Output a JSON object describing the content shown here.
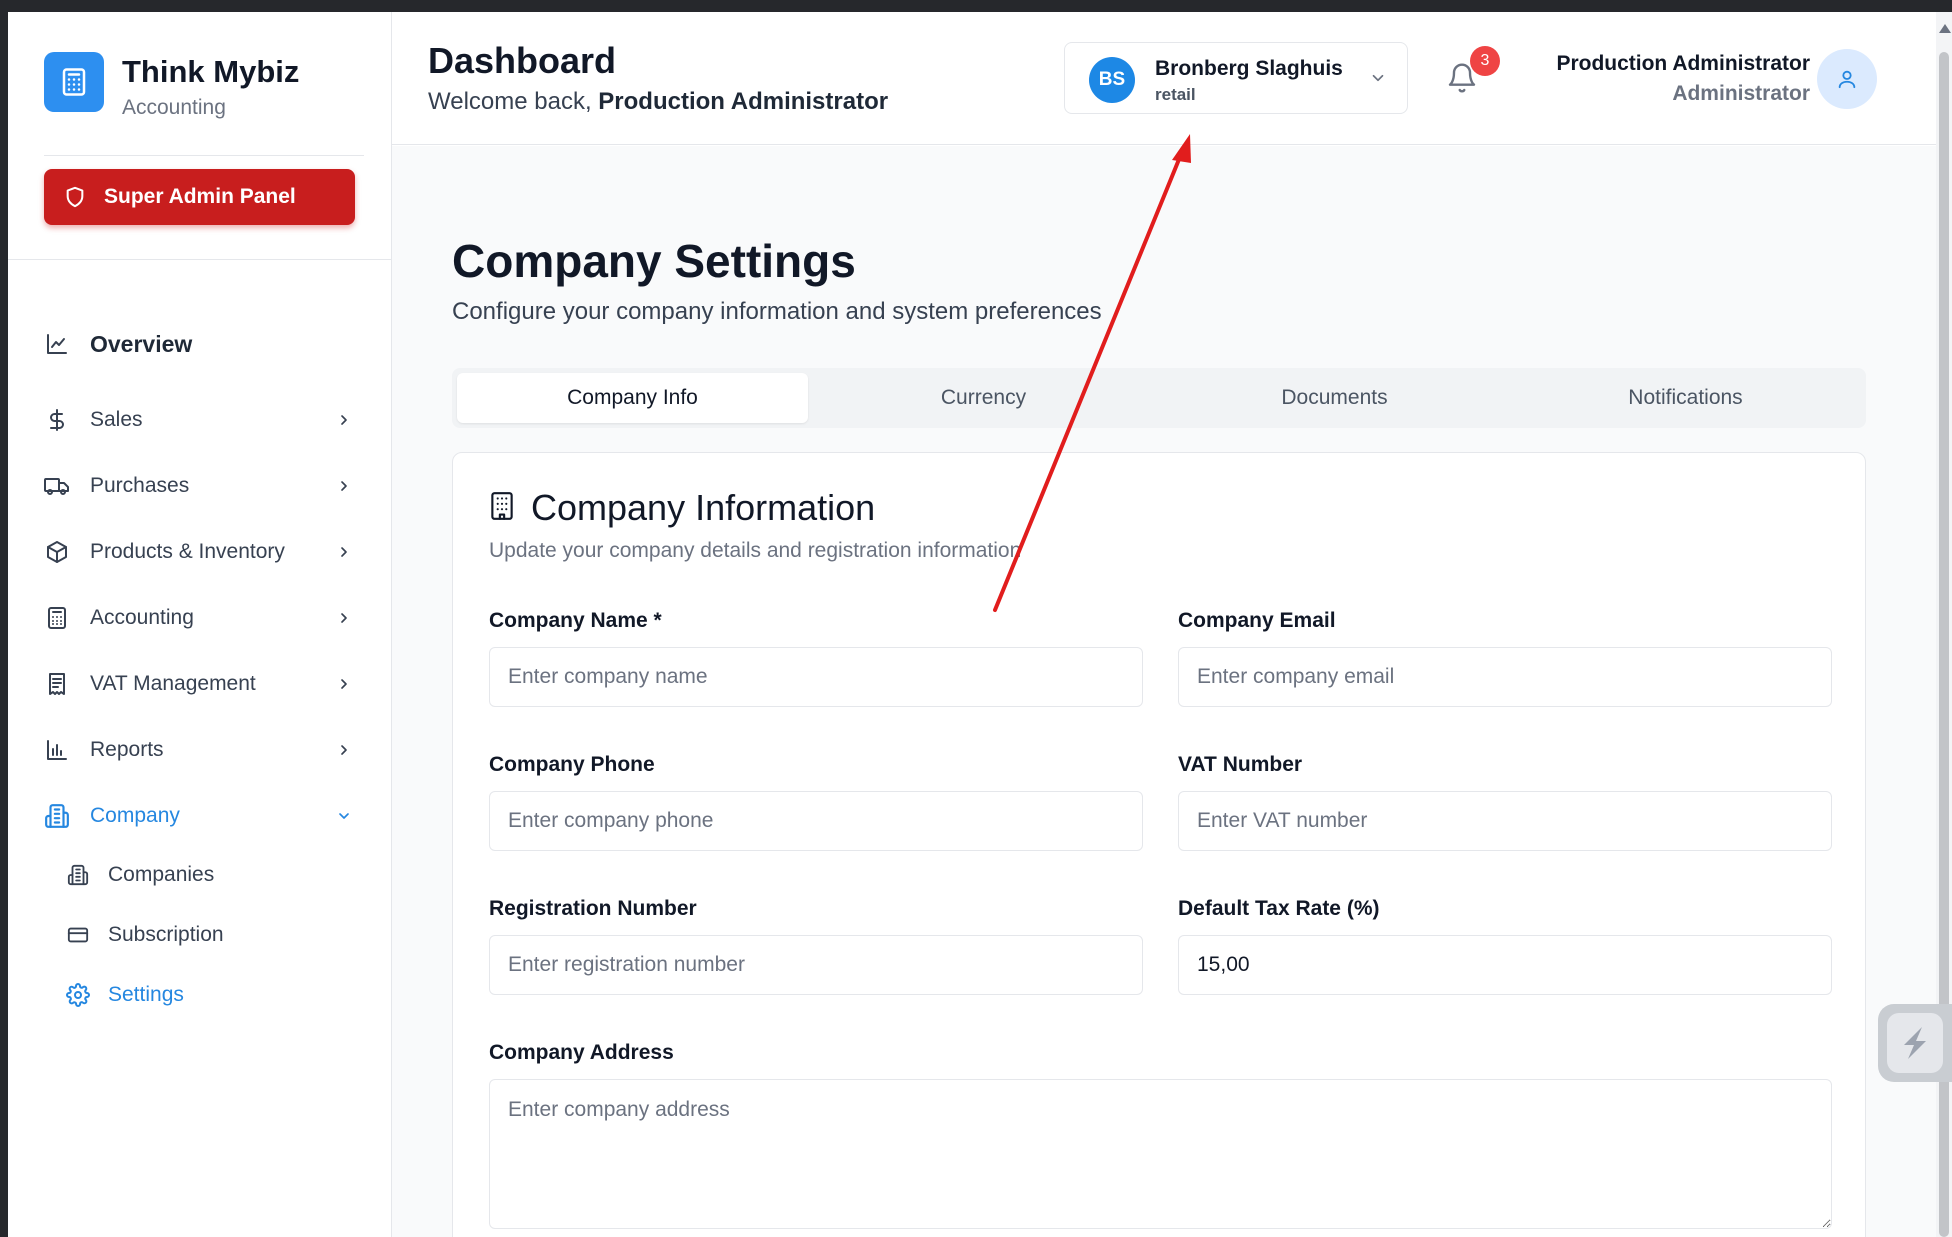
{
  "brand": {
    "name": "Think Mybiz",
    "subtitle": "Accounting"
  },
  "super_admin": {
    "label": "Super Admin Panel"
  },
  "sidebar": {
    "overview": "Overview",
    "items": [
      {
        "label": "Sales",
        "icon": "dollar-icon"
      },
      {
        "label": "Purchases",
        "icon": "truck-icon"
      },
      {
        "label": "Products & Inventory",
        "icon": "box-icon"
      },
      {
        "label": "Accounting",
        "icon": "calculator-icon"
      },
      {
        "label": "VAT Management",
        "icon": "receipt-icon"
      },
      {
        "label": "Reports",
        "icon": "bar-chart-icon"
      },
      {
        "label": "Company",
        "icon": "building-icon"
      }
    ],
    "company_sub": [
      {
        "label": "Companies",
        "icon": "building-icon"
      },
      {
        "label": "Subscription",
        "icon": "credit-card-icon"
      },
      {
        "label": "Settings",
        "icon": "gear-icon"
      }
    ]
  },
  "header": {
    "title": "Dashboard",
    "welcome_prefix": "Welcome back,",
    "welcome_name": "Production Administrator",
    "company": {
      "initials": "BS",
      "name": "Bronberg Slaghuis",
      "type": "retail"
    },
    "notifications_count": "3",
    "user": {
      "name": "Production Administrator",
      "role": "Administrator"
    }
  },
  "main": {
    "title": "Company Settings",
    "subtitle": "Configure your company information and system preferences",
    "tabs": [
      "Company Info",
      "Currency",
      "Documents",
      "Notifications"
    ],
    "active_tab": "Company Info"
  },
  "card": {
    "title": "Company Information",
    "subtitle": "Update your company details and registration information",
    "fields": {
      "company_name": {
        "label": "Company Name *",
        "placeholder": "Enter company name",
        "value": ""
      },
      "company_email": {
        "label": "Company Email",
        "placeholder": "Enter company email",
        "value": ""
      },
      "company_phone": {
        "label": "Company Phone",
        "placeholder": "Enter company phone",
        "value": ""
      },
      "vat_number": {
        "label": "VAT Number",
        "placeholder": "Enter VAT number",
        "value": ""
      },
      "registration_number": {
        "label": "Registration Number",
        "placeholder": "Enter registration number",
        "value": ""
      },
      "default_tax_rate": {
        "label": "Default Tax Rate (%)",
        "placeholder": "",
        "value": "15,00"
      },
      "company_address": {
        "label": "Company Address",
        "placeholder": "Enter company address",
        "value": ""
      }
    }
  },
  "colors": {
    "accent": "#2587e0",
    "danger": "#c81e1e",
    "annotation_arrow": "#e11d1d"
  }
}
